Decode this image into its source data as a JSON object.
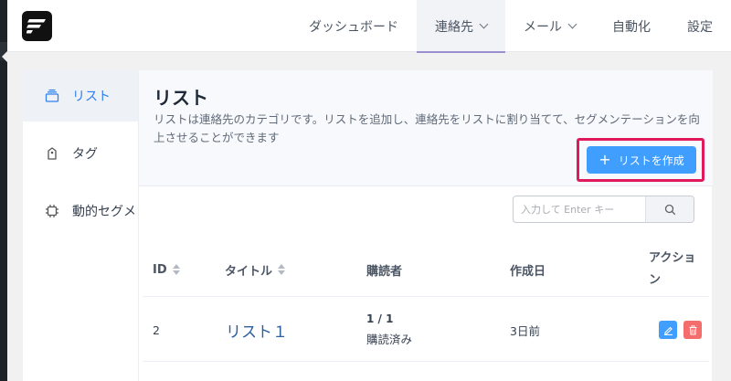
{
  "nav": {
    "items": [
      {
        "label": "ダッシュボード"
      },
      {
        "label": "連絡先"
      },
      {
        "label": "メール"
      },
      {
        "label": "自動化"
      },
      {
        "label": "設定"
      }
    ]
  },
  "sidebar": {
    "items": [
      {
        "label": "リスト",
        "icon": "list-stack-icon"
      },
      {
        "label": "タグ",
        "icon": "tag-icon"
      },
      {
        "label": "動的セグメント",
        "icon": "chip-icon"
      }
    ]
  },
  "main": {
    "title": "リスト",
    "description": "リストは連絡先のカテゴリです。リストを追加し、連絡先をリストに割り当てて、セグメンテーションを向上させることができます",
    "create_button": "リストを作成",
    "search_placeholder": "入力して Enter キー",
    "table": {
      "columns": [
        "ID",
        "タイトル",
        "購読者",
        "作成日",
        "アクション"
      ],
      "rows": [
        {
          "id": "2",
          "title": "リスト１",
          "subscribers_count": "1 / 1",
          "subscribers_status": "購読済み",
          "created": "3日前"
        }
      ]
    }
  },
  "colors": {
    "accent": "#409eff",
    "highlight_border": "#e0195a",
    "delete": "#f56c6c",
    "active_nav_underline": "#9b8fd0"
  }
}
